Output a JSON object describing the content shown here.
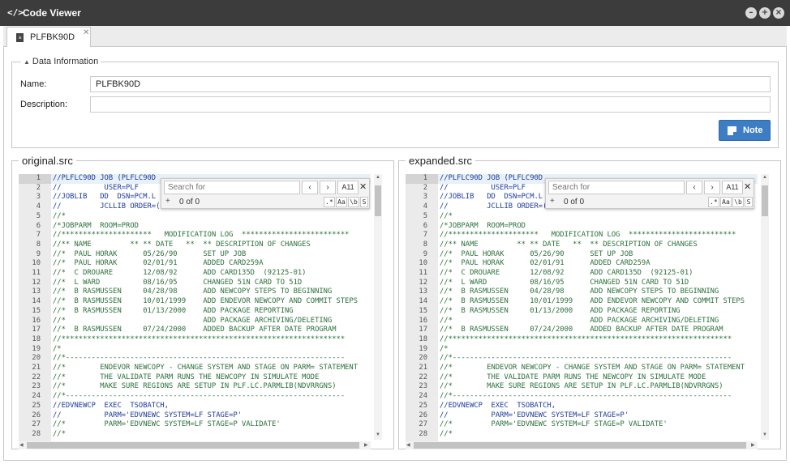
{
  "window": {
    "title": "Code Viewer",
    "app_icon": "</>"
  },
  "tabs": [
    {
      "label": "PLFBK90D"
    }
  ],
  "data_info": {
    "legend": "Data Information",
    "name_label": "Name:",
    "name_value": "PLFBK90D",
    "description_label": "Description:",
    "description_value": "",
    "note_button": "Note"
  },
  "search": {
    "placeholder": "Search for",
    "all_label": "A11",
    "count": "0 of 0",
    "options": [
      ".*",
      "Aa",
      "\\b",
      "S"
    ]
  },
  "panels": [
    {
      "title": "original.src"
    },
    {
      "title": "expanded.src"
    }
  ],
  "code_lines": [
    "//PLFLC90D JOB (PLFLC90D",
    "//          USER=PLF",
    "//JOBLIB   DD  DSN=PCM.L",
    "//         JCLLIB ORDER=(PLFLC.PROCLIB)",
    "//*",
    "/*JOBPARM  ROOM=PROD",
    "//*********************   MODIFICATION LOG  *************************",
    "//** NAME         ** ** DATE   **  ** DESCRIPTION OF CHANGES",
    "//*  PAUL HORAK      05/26/90      SET UP JOB",
    "//*  PAUL HORAK      02/01/91      ADDED CARD259A",
    "//*  C DROUARE       12/08/92      ADD CARD135D  (92125-01)",
    "//*  L WARD          08/16/95      CHANGED 51N CARD TO 51D",
    "//*  B RASMUSSEN     04/28/98      ADD NEWCOPY STEPS TO BEGINNING",
    "//*  B RASMUSSEN     10/01/1999    ADD ENDEVOR NEWCOPY AND COMMIT STEPS",
    "//*  B RASMUSSEN     01/13/2000    ADD PACKAGE REPORTING",
    "//*                                ADD PACKAGE ARCHIVING/DELETING",
    "//*  B RASMUSSEN     07/24/2000    ADDED BACKUP AFTER DATE PROGRAM",
    "//******************************************************************",
    "/*",
    "//*-----------------------------------------------------------------",
    "//*        ENDEVOR NEWCOPY - CHANGE SYSTEM AND STAGE ON PARM= STATEMENT",
    "//*        THE VALIDATE PARM RUNS THE NEWCOPY IN SIMULATE MODE",
    "//*        MAKE SURE REGIONS ARE SETUP IN PLF.LC.PARMLIB(NDVRRGNS)",
    "//*-----------------------------------------------------------------",
    "//EDVNEWCP  EXEC  TSOBATCH,",
    "//          PARM='EDVNEWC SYSTEM=LF STAGE=P'",
    "//*         PARM='EDVNEWC SYSTEM=LF STAGE=P VALIDATE'",
    "//*"
  ]
}
